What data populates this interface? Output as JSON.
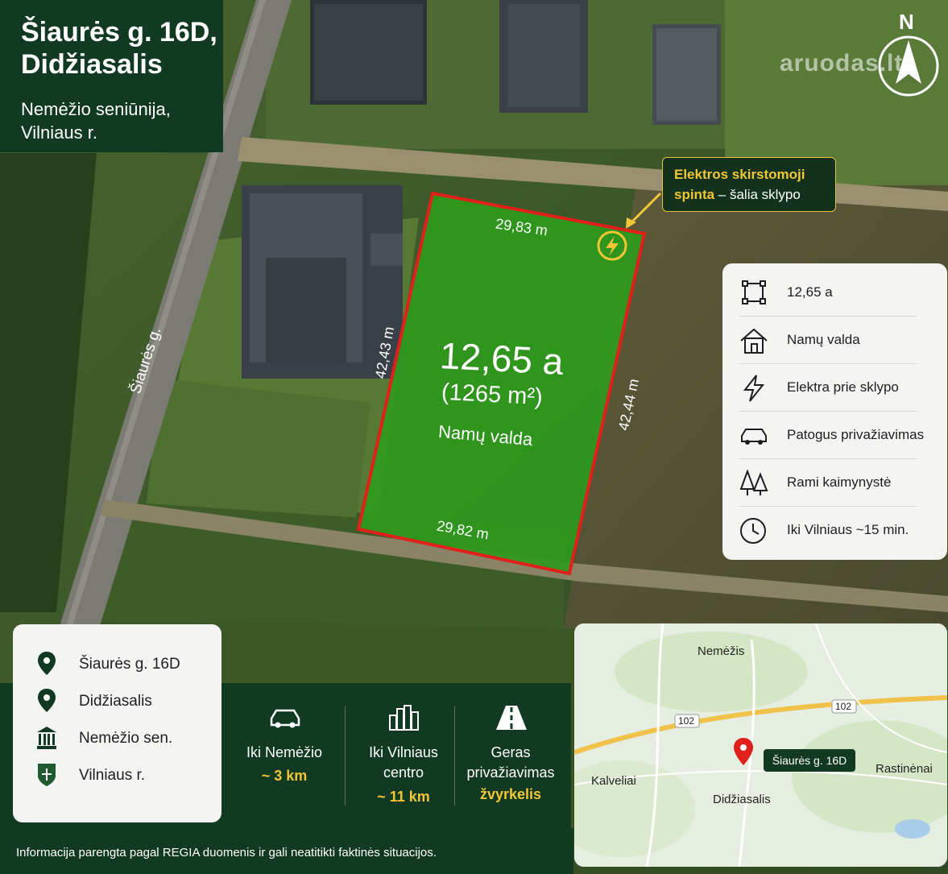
{
  "title": {
    "line1": "Šiaurės g. 16D,",
    "line2": "Didžiasalis",
    "sub1": "Nemėžio seniūnija,",
    "sub2": "Vilniaus r."
  },
  "watermark": "aruodas.lt",
  "north_label": "N",
  "street_label": "Šiaurės g.",
  "plot": {
    "area_big": "12,65 a",
    "area_m2": "(1265 m²)",
    "purpose": "Namų valda",
    "side_top": "29,83 m",
    "side_bottom": "29,82 m",
    "side_left": "42,43 m",
    "side_right": "42,44 m"
  },
  "callout": {
    "highlight": "Elektros skirstomoji spinta",
    "dash_text": "– šalia sklypo",
    "line1": "Elektros skirstomoji",
    "line2a": "spinta",
    "line2b": " – šalia sklypo"
  },
  "features": [
    {
      "icon": "area-icon",
      "label": "12,65 a"
    },
    {
      "icon": "house-icon",
      "label": "Namų valda"
    },
    {
      "icon": "lightning-icon",
      "label": "Elektra prie sklypo"
    },
    {
      "icon": "car-icon",
      "label": "Patogus privažiavimas"
    },
    {
      "icon": "trees-icon",
      "label": "Rami kaimynystė"
    },
    {
      "icon": "clock-icon",
      "label": "Iki Vilniaus ~15 min."
    }
  ],
  "location": [
    {
      "icon": "map-pin-icon",
      "label": "Šiaurės g. 16D"
    },
    {
      "icon": "map-pin-icon",
      "label": "Didžiasalis"
    },
    {
      "icon": "building-icon",
      "label": "Nemėžio sen."
    },
    {
      "icon": "coat-of-arms-icon",
      "label": "Vilniaus r."
    }
  ],
  "distances": [
    {
      "icon": "car-icon",
      "line1": "Iki Nemėžio",
      "line2": "",
      "value": "~ 3 km"
    },
    {
      "icon": "city-icon",
      "line1": "Iki Vilniaus",
      "line2": "centro",
      "value": "~ 11 km"
    },
    {
      "icon": "road-icon",
      "line1": "Geras",
      "line2": "privažiavimas",
      "value": "žvyrkelis"
    }
  ],
  "footer": "Informacija parengta pagal REGIA duomenis ir gali neatitikti faktinės situacijos.",
  "map": {
    "road_number_1": "102",
    "road_number_2": "102",
    "pin_label": "Šiaurės g. 16D",
    "places": [
      "Nemėžis",
      "Kalveliai",
      "Didžiasalis",
      "Rastinėnai"
    ]
  },
  "colors": {
    "dark_green": "#123a22",
    "accent_yellow": "#f2c636",
    "plot_red": "#e0201a",
    "plot_green": "#2f9a1c"
  }
}
